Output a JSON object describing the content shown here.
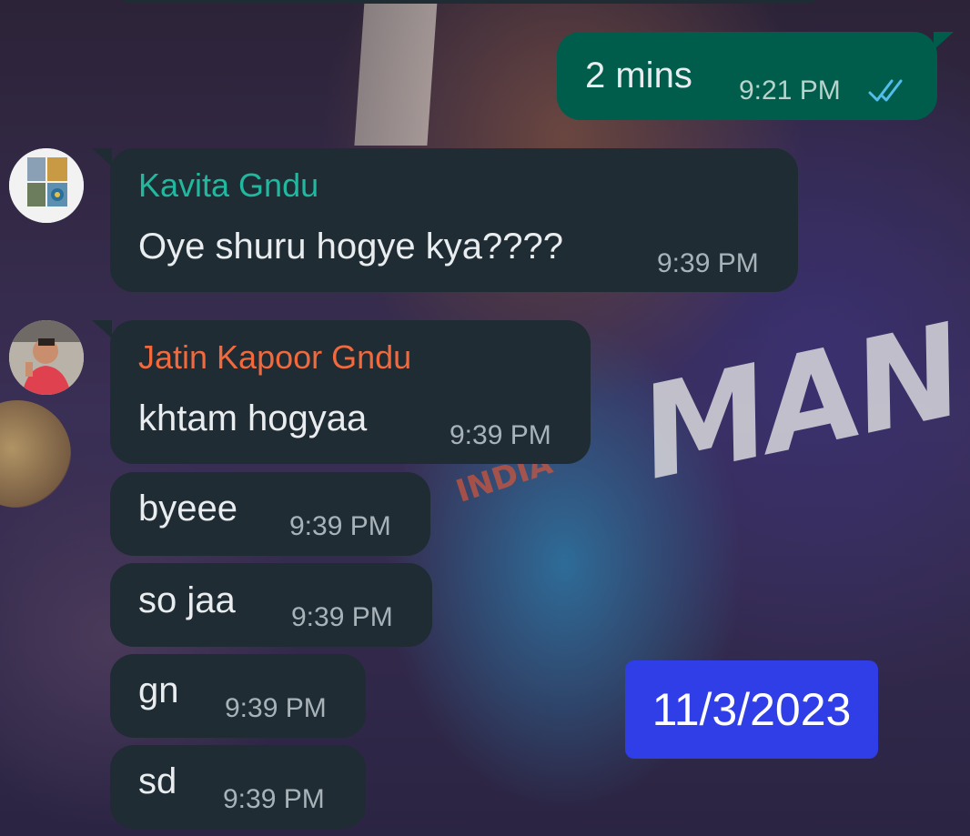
{
  "messages": {
    "outgoing_1": {
      "text": "2 mins",
      "time": "9:21 PM",
      "status_icon": "double-check-read-icon",
      "status_color": "#53bdeb"
    },
    "kavita": {
      "sender": "Kavita Gndu",
      "sender_color": "#21b8a0",
      "text": "Oye shuru hogye kya????",
      "time": "9:39 PM"
    },
    "jatin_1": {
      "sender": "Jatin Kapoor Gndu",
      "sender_color": "#f1693c",
      "text": "khtam hogyaa",
      "time": "9:39 PM"
    },
    "jatin_2": {
      "text": "byeee",
      "time": "9:39 PM"
    },
    "jatin_3": {
      "text": "so jaa",
      "time": "9:39 PM"
    },
    "jatin_4": {
      "text": "gn",
      "time": "9:39 PM"
    },
    "jatin_5": {
      "text": "sd",
      "time": "9:39 PM"
    }
  },
  "overlay": {
    "date_label": "11/3/2023",
    "color": "#2f3ee6"
  },
  "theme": {
    "incoming_bubble": "#1f2c33",
    "outgoing_bubble": "#005c4b"
  }
}
